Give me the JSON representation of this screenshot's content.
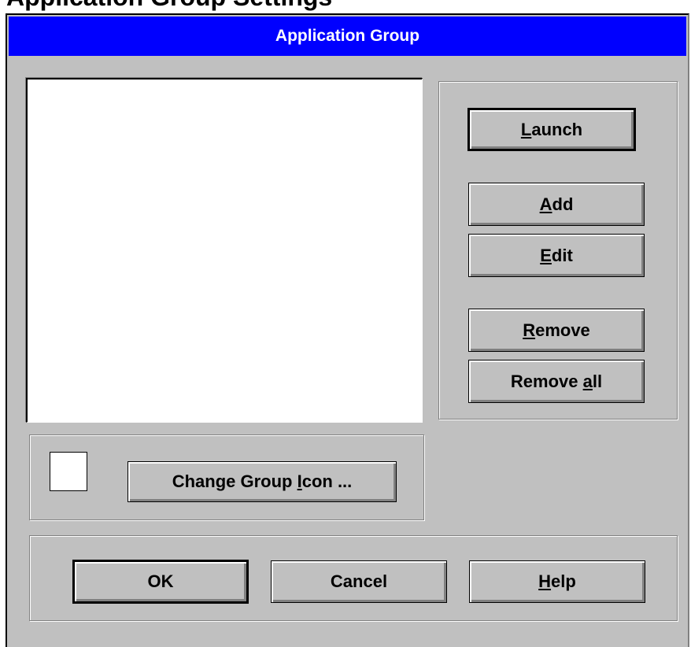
{
  "heading_clipped": "Application Group Settings",
  "dialog": {
    "title": "Application Group"
  },
  "buttons": {
    "launch": {
      "pre": "",
      "key": "L",
      "post": "aunch"
    },
    "add": {
      "pre": "",
      "key": "A",
      "post": "dd"
    },
    "edit": {
      "pre": "",
      "key": "E",
      "post": "dit"
    },
    "remove": {
      "pre": "",
      "key": "R",
      "post": "emove"
    },
    "remove_all": {
      "pre": "Remove ",
      "key": "a",
      "post": "ll"
    },
    "change_icon": {
      "pre": "Change Group ",
      "key": "I",
      "post": "con ..."
    },
    "ok": {
      "label": "OK"
    },
    "cancel": {
      "label": "Cancel"
    },
    "help": {
      "pre": "",
      "key": "H",
      "post": "elp"
    }
  },
  "colors": {
    "face": "#c0c0c0",
    "titlebar": "#0000ff",
    "titletext": "#ffffff"
  }
}
